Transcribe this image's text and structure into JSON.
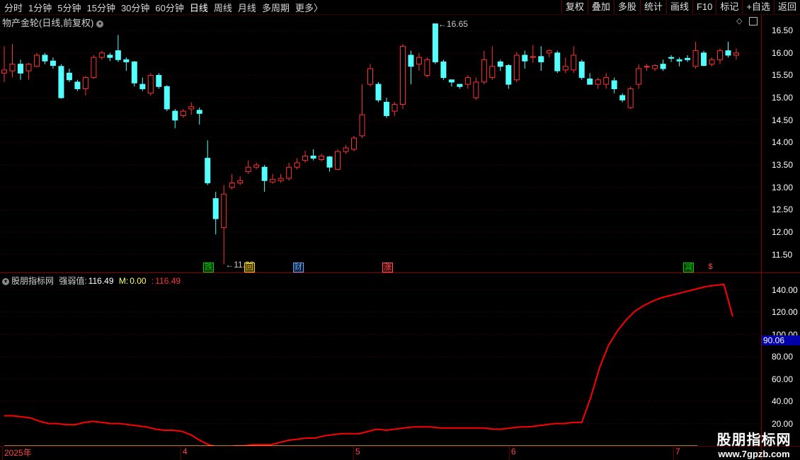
{
  "toolbar": {
    "periods": [
      "分时",
      "1分钟",
      "5分钟",
      "15分钟",
      "30分钟",
      "60分钟",
      "日线",
      "周线",
      "月线",
      "多周期",
      "更多"
    ],
    "active_period": "日线",
    "more_arrow": "〉",
    "actions": [
      "复权",
      "叠加",
      "多股",
      "统计",
      "画线",
      "F10",
      "标记",
      "+自选",
      "返回"
    ]
  },
  "main_chart": {
    "title": "物产金轮(日线,前复权)",
    "high_label": "16.65",
    "low_label": "11.28",
    "y_ticks": [
      "16.50",
      "16.00",
      "15.50",
      "15.00",
      "14.50",
      "14.00",
      "13.50",
      "13.00",
      "12.50",
      "12.00",
      "11.50"
    ],
    "event_badges": [
      {
        "text": "跌",
        "color": "#00cc00",
        "bg": "#003300"
      },
      {
        "text": "回",
        "color": "#ffcc00",
        "bg": "#333300"
      },
      {
        "text": "财",
        "color": "#66aaff",
        "bg": "#001a33"
      },
      {
        "text": "涨",
        "color": "#ff5555",
        "bg": "#330000"
      },
      {
        "text": "减",
        "color": "#00cc00",
        "bg": "#003300"
      },
      {
        "text": "$",
        "color": "#ff4444",
        "bg": "#000000"
      }
    ]
  },
  "indicator": {
    "name": "股朋指标网",
    "strength_label": "强弱值:",
    "strength_value": "116.49",
    "m_label": "M:",
    "m_value": "0.00",
    "extra_value": "116.49",
    "current_axis_value": "90.06",
    "y_ticks": [
      "140.00",
      "120.00",
      "100.00",
      "80.00",
      "60.00",
      "40.00",
      "20.00"
    ]
  },
  "dates": [
    "2025年",
    "4",
    "5",
    "6",
    "7"
  ],
  "watermark": {
    "line1": "股朋指标网",
    "line2": "www.7gpzb.com"
  },
  "colors": {
    "up": "#ff3232",
    "down": "#54ffff",
    "grid": "#3a0000",
    "separator": "#8a0000",
    "strength": "#ff0000",
    "m_line": "#ffff66"
  },
  "chart_data": {
    "type": "candlestick",
    "title": "物产金轮(日线,前复权)",
    "ylim": [
      11.1,
      16.85
    ],
    "candles": [
      [
        15.55,
        15.62,
        16.15,
        15.35
      ],
      [
        15.6,
        15.75,
        16.2,
        15.45
      ],
      [
        15.75,
        15.55,
        15.85,
        15.4
      ],
      [
        15.6,
        15.75,
        15.78,
        15.4
      ],
      [
        15.7,
        15.95,
        16.0,
        15.68
      ],
      [
        15.95,
        15.82,
        16.0,
        15.75
      ],
      [
        15.82,
        15.72,
        15.9,
        15.65
      ],
      [
        15.7,
        15.0,
        15.75,
        14.98
      ],
      [
        15.55,
        15.4,
        15.65,
        15.35
      ],
      [
        15.35,
        15.2,
        15.4,
        15.15
      ],
      [
        15.2,
        15.45,
        15.48,
        15.05
      ],
      [
        15.45,
        15.9,
        15.95,
        15.42
      ],
      [
        15.9,
        16.0,
        16.05,
        15.85
      ],
      [
        15.95,
        15.9,
        16.0,
        15.82
      ],
      [
        16.05,
        15.85,
        16.4,
        15.8
      ],
      [
        15.85,
        15.8,
        15.9,
        15.6
      ],
      [
        15.8,
        15.33,
        15.82,
        15.25
      ],
      [
        15.3,
        15.2,
        15.45,
        15.15
      ],
      [
        15.1,
        15.5,
        15.55,
        15.05
      ],
      [
        15.5,
        15.25,
        15.55,
        15.2
      ],
      [
        15.25,
        14.75,
        15.28,
        14.7
      ],
      [
        14.7,
        14.5,
        14.75,
        14.32
      ],
      [
        14.6,
        14.7,
        14.75,
        14.55
      ],
      [
        14.75,
        14.8,
        14.9,
        14.62
      ],
      [
        14.72,
        14.65,
        14.78,
        14.4
      ],
      [
        13.65,
        13.1,
        14.05,
        13.05
      ],
      [
        12.75,
        12.3,
        12.9,
        11.95
      ],
      [
        12.1,
        12.85,
        13.05,
        11.28
      ],
      [
        13.0,
        13.1,
        13.3,
        12.95
      ],
      [
        13.1,
        13.15,
        13.25,
        13.05
      ],
      [
        13.35,
        13.45,
        13.6,
        13.3
      ],
      [
        13.45,
        13.5,
        13.55,
        13.4
      ],
      [
        13.45,
        13.15,
        13.5,
        12.9
      ],
      [
        13.12,
        13.18,
        13.3,
        13.08
      ],
      [
        13.15,
        13.2,
        13.3,
        13.1
      ],
      [
        13.2,
        13.45,
        13.55,
        13.15
      ],
      [
        13.45,
        13.55,
        13.65,
        13.4
      ],
      [
        13.6,
        13.7,
        13.82,
        13.55
      ],
      [
        13.7,
        13.65,
        13.85,
        13.6
      ],
      [
        13.62,
        13.7,
        13.75,
        13.58
      ],
      [
        13.68,
        13.45,
        13.7,
        13.35
      ],
      [
        13.4,
        13.8,
        13.85,
        13.38
      ],
      [
        13.8,
        13.88,
        13.95,
        13.75
      ],
      [
        13.85,
        14.1,
        14.15,
        13.8
      ],
      [
        14.15,
        14.62,
        15.3,
        14.1
      ],
      [
        15.3,
        15.65,
        15.75,
        15.25
      ],
      [
        15.3,
        14.95,
        15.35,
        14.9
      ],
      [
        14.9,
        14.6,
        15.0,
        14.55
      ],
      [
        14.7,
        14.85,
        14.9,
        14.6
      ],
      [
        14.85,
        16.15,
        16.2,
        14.75
      ],
      [
        15.95,
        15.7,
        16.05,
        15.3
      ],
      [
        15.75,
        15.9,
        16.0,
        15.6
      ],
      [
        15.5,
        15.85,
        15.9,
        15.45
      ],
      [
        16.65,
        15.8,
        16.65,
        15.75
      ],
      [
        15.8,
        15.45,
        15.85,
        15.4
      ],
      [
        15.4,
        15.35,
        15.4,
        15.25
      ],
      [
        15.3,
        15.25,
        15.3,
        15.2
      ],
      [
        15.3,
        15.45,
        15.5,
        15.2
      ],
      [
        15.0,
        15.35,
        15.45,
        14.95
      ],
      [
        15.35,
        15.85,
        16.05,
        15.3
      ],
      [
        15.45,
        15.7,
        16.15,
        15.4
      ],
      [
        15.8,
        15.7,
        15.85,
        15.6
      ],
      [
        15.72,
        15.3,
        15.75,
        15.2
      ],
      [
        15.4,
        15.95,
        16.02,
        15.35
      ],
      [
        15.95,
        15.82,
        16.05,
        15.65
      ],
      [
        15.9,
        15.92,
        16.18,
        15.78
      ],
      [
        15.92,
        15.8,
        16.15,
        15.6
      ],
      [
        16.0,
        16.05,
        16.08,
        15.9
      ],
      [
        16.0,
        15.6,
        16.05,
        15.55
      ],
      [
        15.62,
        15.7,
        15.9,
        15.55
      ],
      [
        15.62,
        15.95,
        16.15,
        15.55
      ],
      [
        15.8,
        15.45,
        15.85,
        15.4
      ],
      [
        15.42,
        15.3,
        15.55,
        15.3
      ],
      [
        15.3,
        15.4,
        15.45,
        15.2
      ],
      [
        15.3,
        15.45,
        15.55,
        15.2
      ],
      [
        15.38,
        15.2,
        15.45,
        15.1
      ],
      [
        15.05,
        14.95,
        15.1,
        14.9
      ],
      [
        14.78,
        15.2,
        15.25,
        14.75
      ],
      [
        15.3,
        15.65,
        15.75,
        15.2
      ],
      [
        15.7,
        15.7,
        15.75,
        15.6
      ],
      [
        15.65,
        15.72,
        15.75,
        15.6
      ],
      [
        15.75,
        15.65,
        15.85,
        15.6
      ],
      [
        15.9,
        15.88,
        15.95,
        15.8
      ],
      [
        15.85,
        15.82,
        15.9,
        15.7
      ],
      [
        15.88,
        15.85,
        15.95,
        15.8
      ],
      [
        15.7,
        16.05,
        16.25,
        15.65
      ],
      [
        16.0,
        15.72,
        16.05,
        15.7
      ],
      [
        15.75,
        15.85,
        15.9,
        15.7
      ],
      [
        15.85,
        16.05,
        16.1,
        15.75
      ],
      [
        16.05,
        15.95,
        16.25,
        15.9
      ],
      [
        15.95,
        16.0,
        16.1,
        15.85
      ]
    ],
    "indicator_series": [
      {
        "name": "强弱值",
        "values": [
          27,
          27,
          26,
          25,
          22,
          20,
          20,
          19,
          19,
          21,
          22,
          21,
          20,
          20,
          19,
          18,
          17,
          15,
          14,
          14,
          13,
          10,
          5,
          1,
          -1,
          -1,
          0,
          0,
          1,
          1,
          1,
          3,
          5,
          6,
          7,
          7,
          9,
          10,
          11,
          11,
          11,
          13,
          15,
          14,
          15,
          16,
          17,
          17,
          17,
          16,
          16,
          16,
          16,
          16,
          16,
          15,
          15,
          16,
          17,
          17,
          18,
          19,
          20,
          20,
          21,
          21,
          43,
          70,
          90,
          103,
          113,
          121,
          126,
          130,
          133,
          135,
          137,
          139,
          141,
          143,
          144,
          145,
          116
        ]
      },
      {
        "name": "M",
        "values": [
          0
        ]
      }
    ],
    "indicator_ylim": [
      0,
      155
    ]
  }
}
